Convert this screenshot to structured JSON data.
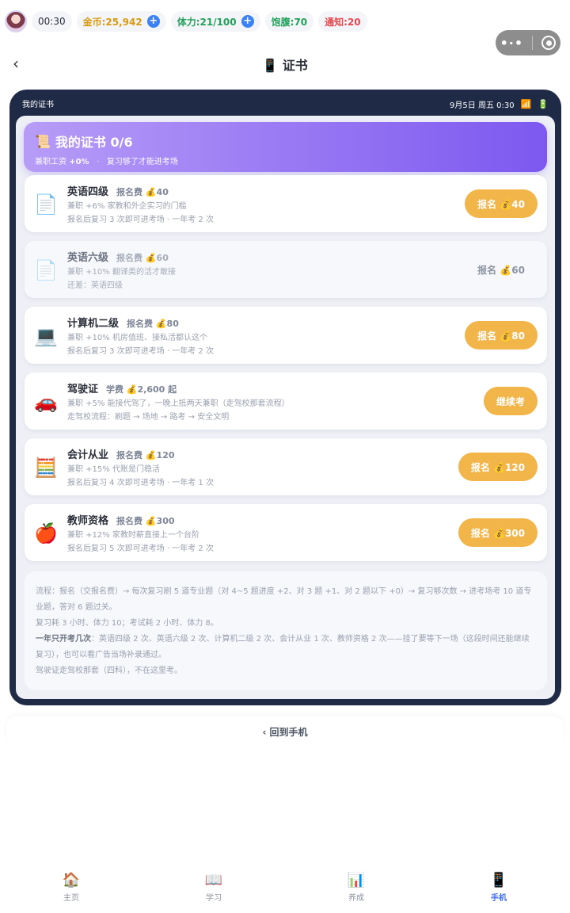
{
  "status": {
    "time": "00:30",
    "gold": "金币:25,942",
    "energy": "体力:21/100",
    "full": "饱腹:70",
    "notice": "通知:20"
  },
  "nav": {
    "back": "‹",
    "title": "📱 证书"
  },
  "phone": {
    "app_name": "我的证书",
    "datetime": "9月5日 周五 0:30"
  },
  "hero": {
    "title": "我的证书 0/6",
    "sub_prefix": "兼职工资",
    "sub_value": "+0%",
    "sub_dot": "·",
    "sub_tip": "复习够了才能进考场"
  },
  "certs": [
    {
      "icon": "📄",
      "name": "英语四级",
      "fee": "报名费 💰40",
      "line2": "兼职 +6%    家教和外企实习的门槛",
      "line3": "报名后复习 3 次即可进考场    ·    一年考 2 次",
      "button": "报名 💰40",
      "enabled": true
    },
    {
      "icon": "📄",
      "name": "英语六级",
      "fee": "报名费 💰60",
      "line2": "兼职 +10%    翻译类的活才敢接",
      "line3": "还差：英语四级",
      "button": "报名 💰60",
      "enabled": false
    },
    {
      "icon": "💻",
      "name": "计算机二级",
      "fee": "报名费 💰80",
      "line2": "兼职 +10%    机房值班、接私活都认这个",
      "line3": "报名后复习 3 次即可进考场    ·    一年考 2 次",
      "button": "报名 💰80",
      "enabled": true
    },
    {
      "icon": "🚗",
      "name": "驾驶证",
      "fee": "学费 💰2,600 起",
      "line2": "兼职 +5%    能接代驾了，一晚上抵两天兼职（走驾校那套流程）",
      "line3": "走驾校流程：刷题 → 场地 → 路考 → 安全文明",
      "button": "继续考",
      "enabled": true
    },
    {
      "icon": "🧮",
      "name": "会计从业",
      "fee": "报名费 💰120",
      "line2": "兼职 +15%    代账是门稳活",
      "line3": "报名后复习 4 次即可进考场    ·    一年考 1 次",
      "button": "报名 💰120",
      "enabled": true
    },
    {
      "icon": "🍎",
      "name": "教师资格",
      "fee": "报名费 💰300",
      "line2": "兼职 +12%    家教时薪直接上一个台阶",
      "line3": "报名后复习 5 次即可进考场    ·    一年考 2 次",
      "button": "报名 💰300",
      "enabled": true
    }
  ],
  "notes": {
    "flow": "流程：报名（交报名费）→ 每次复习刷 5 道专业题（对 4~5 题进度 +2、对 3 题 +1、对 2 题以下 +0）→ 复习够次数 → 进考场考 10 道专业题，答对 6 题过关。",
    "cost": "复习耗 3 小时、体力 10；考试耗 2 小时、体力 8。",
    "limit_label": "一年只开考几次",
    "limit_text": "：英语四级 2 次、英语六级 2 次、计算机二级 2 次、会计从业 1 次、教师资格 2 次——挂了要等下一场（这段时间还能继续复习），也可以看广告当场补录通过。",
    "drive": "驾驶证走驾校那套（四科），不在这里考。"
  },
  "return_label": "‹ 回到手机",
  "tabs": [
    {
      "icon": "🏠",
      "label": "主页"
    },
    {
      "icon": "📖",
      "label": "学习"
    },
    {
      "icon": "📊",
      "label": "养成"
    },
    {
      "icon": "📱",
      "label": "手机"
    }
  ],
  "colors": {
    "accent": "#7d58f0",
    "button": "#f2b54a",
    "tab_active": "#3b6cf6",
    "phone_frame": "#1f2b46"
  }
}
